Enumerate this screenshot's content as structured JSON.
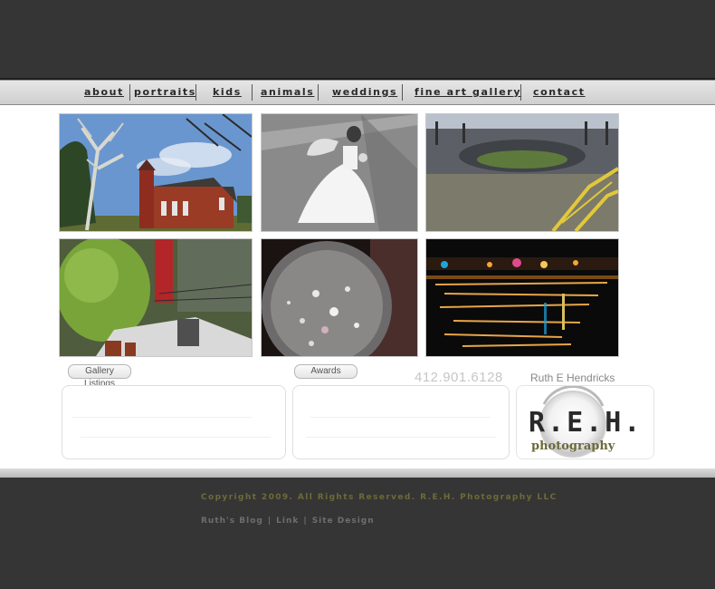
{
  "nav": {
    "items": [
      {
        "label": "about"
      },
      {
        "label": "portraits"
      },
      {
        "label": "kids"
      },
      {
        "label": "animals"
      },
      {
        "label": "weddings"
      },
      {
        "label": "fine art gallery"
      },
      {
        "label": "contact"
      }
    ]
  },
  "gallery": {
    "photos": [
      {
        "name": "church-photo"
      },
      {
        "name": "bride-photo"
      },
      {
        "name": "stadium-photo"
      },
      {
        "name": "rooftop-photo"
      },
      {
        "name": "crystal-ball-photo"
      },
      {
        "name": "night-lights-photo"
      }
    ]
  },
  "sections": {
    "gallery_listings_label": "Gallery Listings",
    "awards_label": "Awards"
  },
  "contact": {
    "phone": "412.901.6128",
    "owner": "Ruth E Hendricks"
  },
  "logo": {
    "text": "R.E.H.",
    "subtext": "photography"
  },
  "footer": {
    "copyright": "Copyright 2009. All Rights Reserved. R.E.H. Photography LLC",
    "links": [
      "Ruth's Blog",
      "Link",
      "Site Design"
    ]
  },
  "colors": {
    "header_bg": "#353535",
    "nav_bg": "#d8d8d8",
    "copyright_text": "#6e6a38",
    "footer_link_text": "#6e6e6e"
  }
}
